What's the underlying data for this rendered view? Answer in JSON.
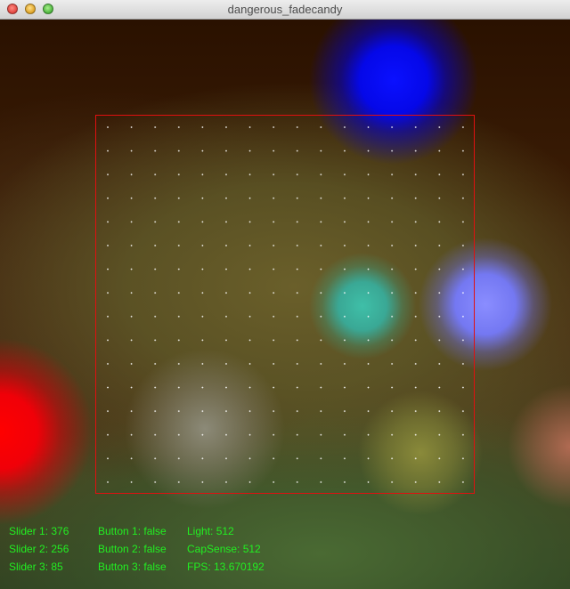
{
  "window": {
    "title": "dangerous_fadecandy"
  },
  "status": {
    "slider_1": "Slider 1: 376",
    "slider_2": "Slider 2: 256",
    "slider_3": "Slider 3: 85",
    "button_1": "Button 1: false",
    "button_2": "Button 2: false",
    "button_3": "Button 3: false",
    "light": "Light: 512",
    "capsense": "CapSense: 512",
    "fps": "FPS: 13.670192"
  },
  "colors": {
    "readout_text": "#22ee22",
    "grid_frame": "#e01010",
    "grid_dot": "#ffffff"
  }
}
